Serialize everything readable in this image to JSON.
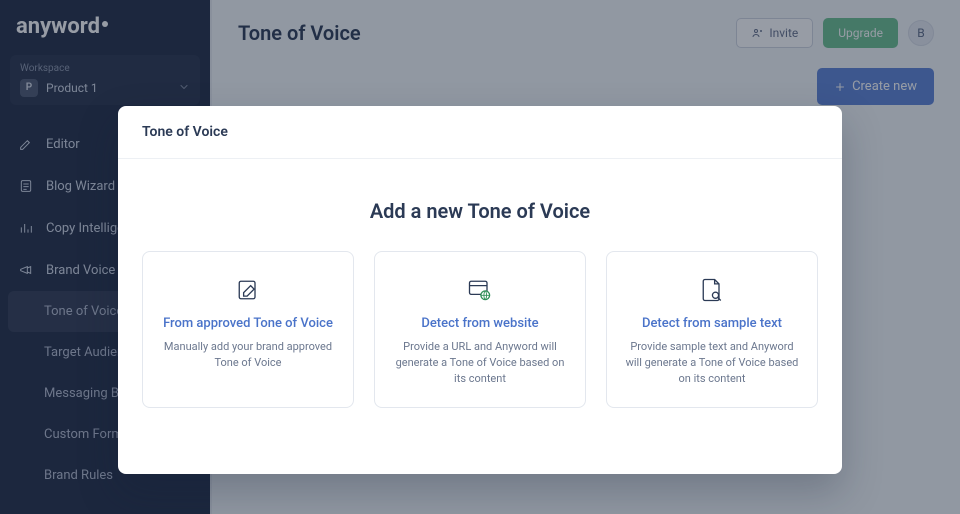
{
  "brand": {
    "name": "anyword"
  },
  "workspace": {
    "label": "Workspace",
    "badge": "P",
    "name": "Product 1"
  },
  "nav": {
    "items": [
      {
        "label": "Editor"
      },
      {
        "label": "Blog Wizard"
      },
      {
        "label": "Copy Intelligence"
      },
      {
        "label": "Brand Voice"
      }
    ],
    "sub": [
      {
        "label": "Tone of Voice",
        "active": true
      },
      {
        "label": "Target Audiences"
      },
      {
        "label": "Messaging Bank"
      },
      {
        "label": "Custom Formulas"
      },
      {
        "label": "Brand Rules"
      }
    ]
  },
  "header": {
    "title": "Tone of Voice",
    "invite": "Invite",
    "upgrade": "Upgrade",
    "avatar": "B",
    "create": "Create new"
  },
  "modal": {
    "header": "Tone of Voice",
    "title": "Add a new Tone of Voice",
    "options": [
      {
        "title": "From approved Tone of Voice",
        "desc": "Manually add your brand approved Tone of Voice"
      },
      {
        "title": "Detect from website",
        "desc": "Provide a URL and Anyword will generate a Tone of Voice based on its content"
      },
      {
        "title": "Detect from sample text",
        "desc": "Provide sample text and Anyword will generate a Tone of Voice based on its content"
      }
    ]
  }
}
